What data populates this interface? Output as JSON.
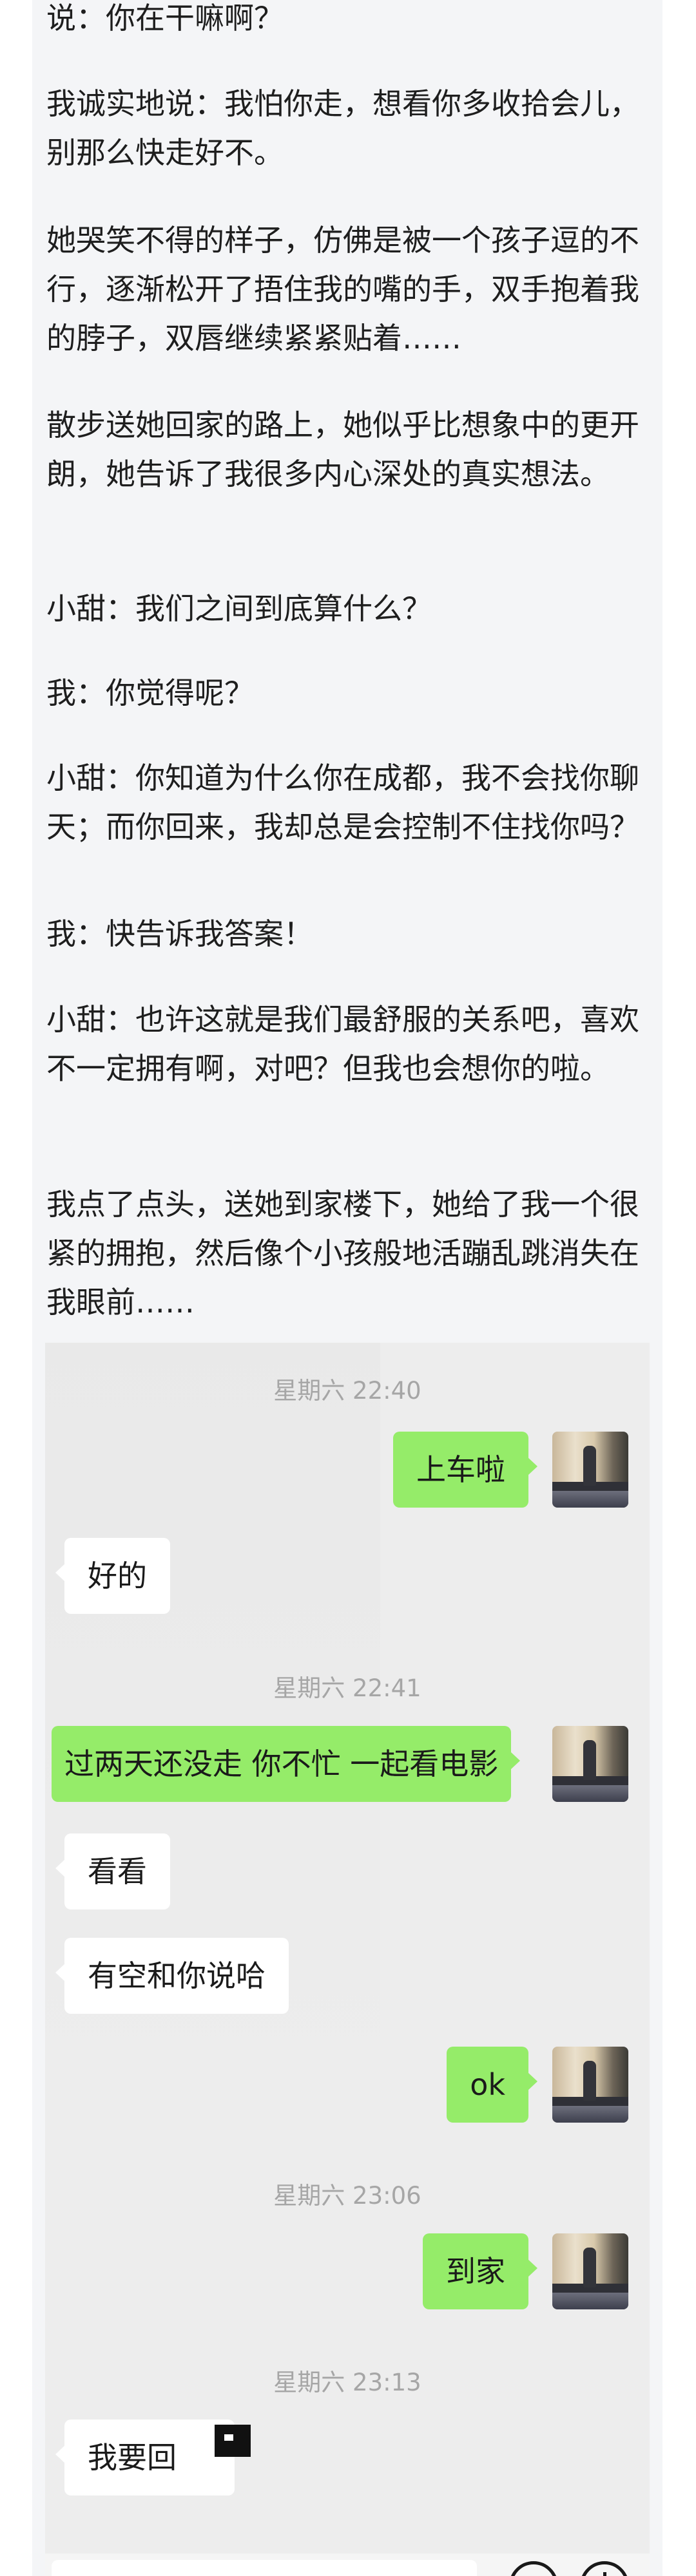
{
  "article": {
    "paragraphs": [
      "说：你在干嘛啊？",
      "我诚实地说：我怕你走，想看你多收拾会儿，别那么快走好不。",
      "她哭笑不得的样子，仿佛是被一个孩子逗的不行，逐渐松开了捂住我的嘴的手，双手抱着我的脖子，双唇继续紧紧贴着……",
      "散步送她回家的路上，她似乎比想象中的更开朗，她告诉了我很多内心深处的真实想法。",
      "小甜：我们之间到底算什么？",
      "我：你觉得呢？",
      "小甜：你知道为什么你在成都，我不会找你聊天；而你回来，我却总是会控制不住找你吗？",
      "我：快告诉我答案！",
      "小甜：也许这就是我们最舒服的关系吧，喜欢不一定拥有啊，对吧？但我也会想你的啦。",
      "我点了点头，送她到家楼下，她给了我一个很紧的拥抱，然后像个小孩般地活蹦乱跳消失在我眼前……"
    ]
  },
  "chat": {
    "timestamps": [
      "星期六 22:40",
      "星期六 22:41",
      "星期六 23:06",
      "星期六 23:13"
    ],
    "messages": [
      {
        "side": "out",
        "text": "上车啦"
      },
      {
        "side": "in",
        "text": "好的"
      },
      {
        "side": "out",
        "text": "过两天还没走 你不忙 一起看电影"
      },
      {
        "side": "in",
        "text": "看看"
      },
      {
        "side": "in",
        "text": "有空和你说哈"
      },
      {
        "side": "out",
        "text": "ok"
      },
      {
        "side": "out",
        "text": "到家"
      },
      {
        "side": "in",
        "text": "我要回"
      }
    ],
    "colors": {
      "outgoing_bubble": "#95ec69",
      "incoming_bubble": "#ffffff",
      "background": "#ededed",
      "timestamp": "#a6a6a6"
    },
    "icons": [
      "emoji-icon",
      "plus-icon"
    ]
  }
}
